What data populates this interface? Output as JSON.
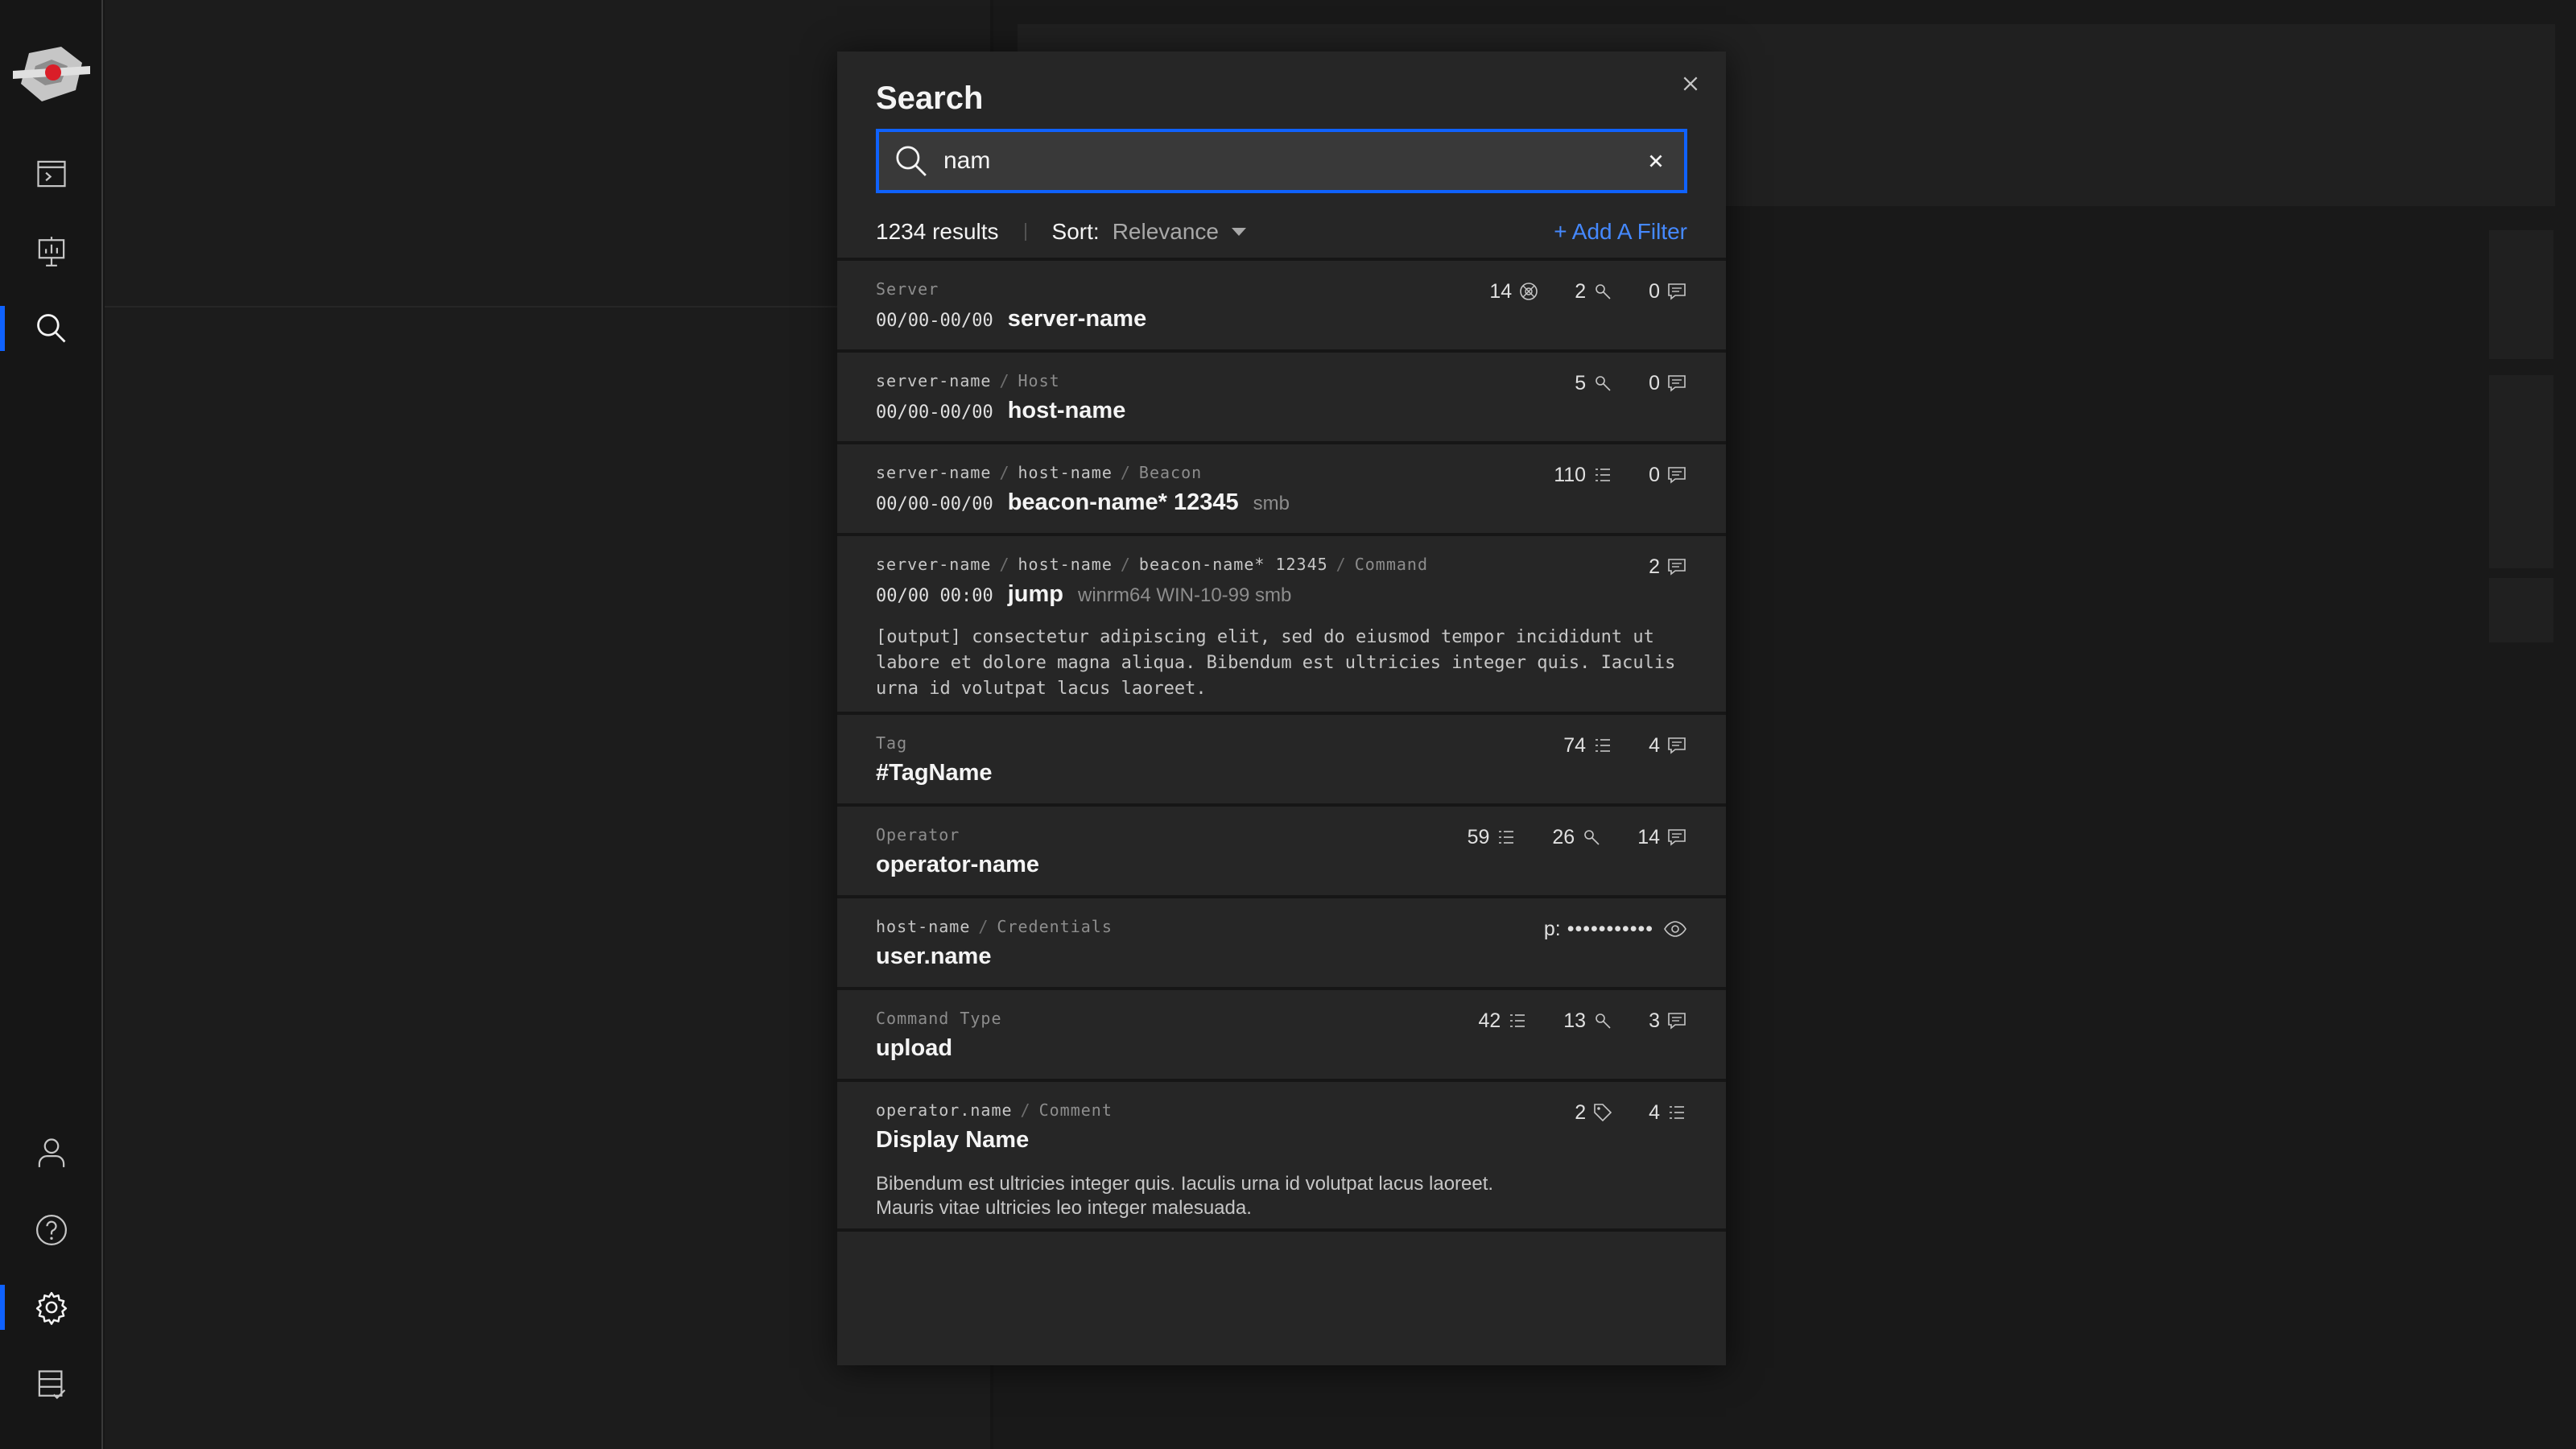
{
  "modal": {
    "title": "Search",
    "search": {
      "value": "nam",
      "placeholder": ""
    },
    "results_count": "1234 results",
    "sort_label": "Sort:",
    "sort_value": "Relevance",
    "add_filter": "+ Add A Filter"
  },
  "results": {
    "server": {
      "type": "Server",
      "timestamp": "00/00-00/00",
      "name": "server-name",
      "stat_hosts": "14",
      "stat_beacons": "2",
      "stat_comments": "0"
    },
    "host": {
      "parent": "server-name",
      "type": "Host",
      "timestamp": "00/00-00/00",
      "name": "host-name",
      "stat_beacons": "5",
      "stat_comments": "0"
    },
    "beacon": {
      "parent1": "server-name",
      "parent2": "host-name",
      "type": "Beacon",
      "timestamp": "00/00-00/00",
      "name": "beacon-name* 12345",
      "extra": "smb",
      "stat_commands": "110",
      "stat_comments": "0"
    },
    "command": {
      "parent1": "server-name",
      "parent2": "host-name",
      "parent3": "beacon-name* 12345",
      "type": "Command",
      "timestamp": "00/00 00:00",
      "name": "jump",
      "extra": "winrm64 WIN-10-99 smb",
      "output": "[output] consectetur adipiscing elit, sed do eiusmod tempor incididunt ut labore et dolore magna aliqua. Bibendum est ultricies integer quis. Iaculis urna id volutpat lacus laoreet.",
      "stat_comments": "2"
    },
    "tag": {
      "type": "Tag",
      "name": "#TagName",
      "stat_commands": "74",
      "stat_comments": "4"
    },
    "operator": {
      "type": "Operator",
      "name": "operator-name",
      "stat_commands": "59",
      "stat_beacons": "26",
      "stat_comments": "14"
    },
    "credentials": {
      "parent": "host-name",
      "type": "Credentials",
      "name": "user.name",
      "password_label": "p:",
      "password_mask": "•••••••••••"
    },
    "command_type": {
      "type": "Command Type",
      "name": "upload",
      "stat_commands": "42",
      "stat_beacons": "13",
      "stat_comments": "3"
    },
    "comment": {
      "parent": "operator.name",
      "type": "Comment",
      "name": "Display Name",
      "body_line1": "Bibendum est ultricies integer quis. Iaculis urna id volutpat lacus laoreet.",
      "body_line2": "Mauris vitae ultricies leo integer malesuada.",
      "stat_tags": "2",
      "stat_commands": "4"
    }
  },
  "icons": {
    "rail_top": [
      "terminal-window-icon",
      "presentation-chart-icon",
      "search-icon"
    ],
    "rail_bottom": [
      "user-icon",
      "help-icon",
      "settings-icon",
      "checklist-icon"
    ],
    "stats": [
      "server-hosts-icon",
      "beacon-icon",
      "comment-icon",
      "list-icon",
      "tag-icon",
      "eye-icon"
    ]
  },
  "colors": {
    "accent": "#0f62fe",
    "link": "#4589ff",
    "modal_bg": "#262626",
    "page_bg": "#161616"
  }
}
